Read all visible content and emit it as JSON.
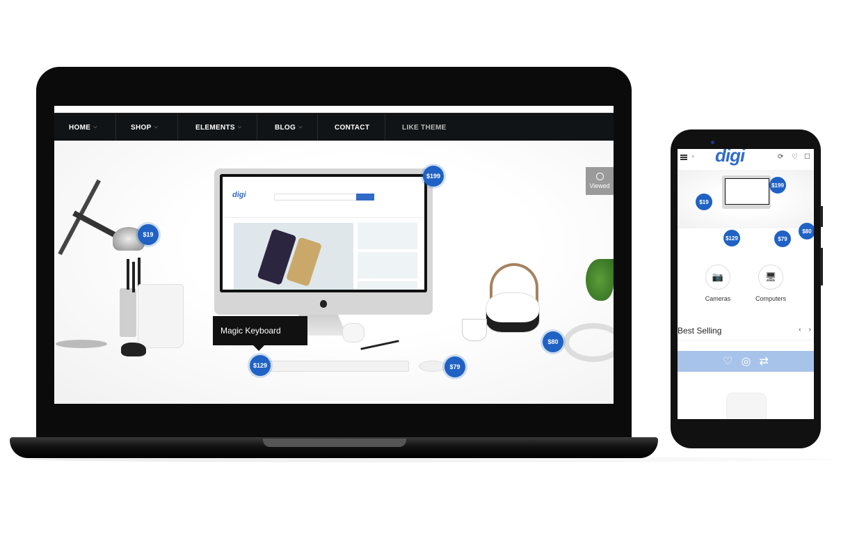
{
  "laptop": {
    "nav": [
      {
        "label": "HOME",
        "has_dropdown": true
      },
      {
        "label": "SHOP",
        "has_dropdown": true
      },
      {
        "label": "ELEMENTS",
        "has_dropdown": true
      },
      {
        "label": "BLOG",
        "has_dropdown": true
      },
      {
        "label": "CONTACT",
        "has_dropdown": false
      },
      {
        "label": "LIKE THEME",
        "has_dropdown": false
      }
    ],
    "tooltip": "Magic Keyboard",
    "viewed_label": "Viewed",
    "prices": {
      "monitor": "$199",
      "lamp": "$19",
      "keyboard": "$129",
      "mouse": "$79",
      "headphones": "$80"
    }
  },
  "phone": {
    "logo": "digi",
    "prices": {
      "monitor": "$199",
      "lamp": "$19",
      "keyboard": "$129",
      "mouse": "$79",
      "headphones": "$80"
    },
    "categories": [
      {
        "label": "Cameras",
        "icon": "camera-icon"
      },
      {
        "label": "Computers",
        "icon": "monitor-icon"
      }
    ],
    "section_title": "Best Selling"
  },
  "colors": {
    "accent": "#1f62c4",
    "nav_bg": "#111416",
    "action_bar": "#a8c3ea"
  }
}
